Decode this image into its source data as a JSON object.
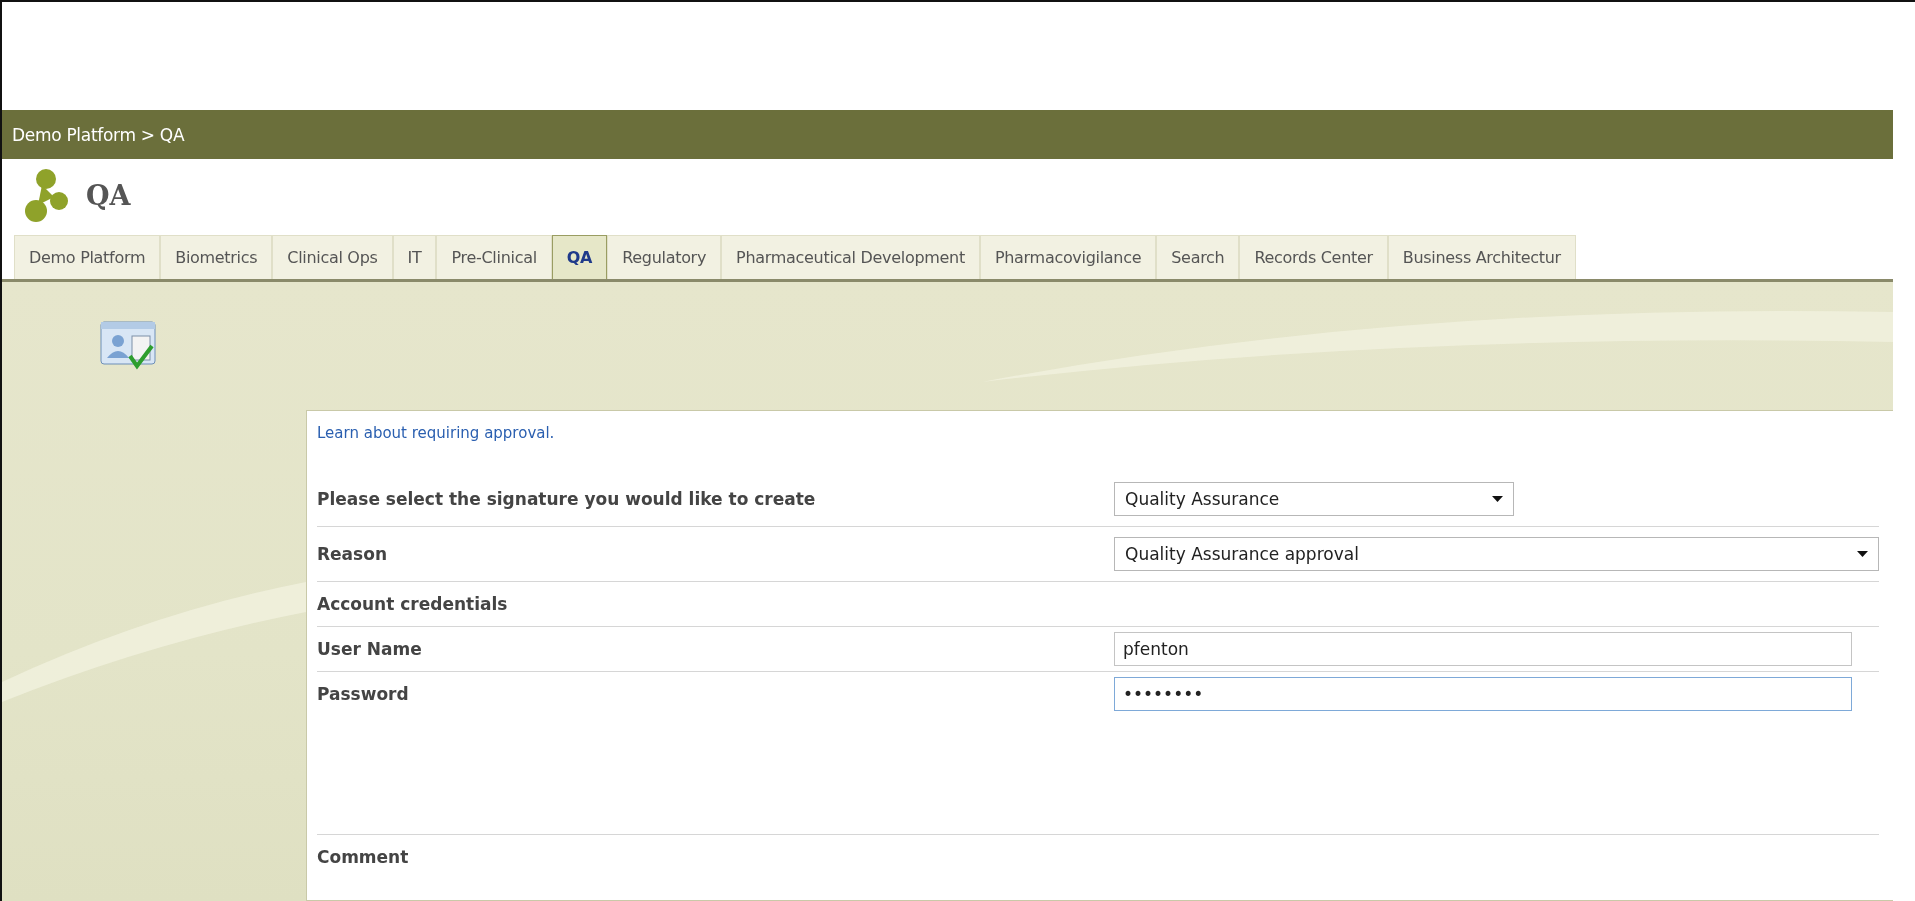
{
  "breadcrumb": "Demo Platform > QA",
  "site": {
    "title": "QA"
  },
  "tabs": [
    {
      "label": "Demo Platform",
      "selected": false
    },
    {
      "label": "Biometrics",
      "selected": false
    },
    {
      "label": "Clinical Ops",
      "selected": false
    },
    {
      "label": "IT",
      "selected": false
    },
    {
      "label": "Pre-Clinical",
      "selected": false
    },
    {
      "label": "QA",
      "selected": true
    },
    {
      "label": "Regulatory",
      "selected": false
    },
    {
      "label": "Pharmaceutical Development",
      "selected": false
    },
    {
      "label": "Pharmacovigilance",
      "selected": false
    },
    {
      "label": "Search",
      "selected": false
    },
    {
      "label": "Records Center",
      "selected": false
    },
    {
      "label": "Business Architectur",
      "selected": false
    }
  ],
  "form": {
    "link": "Learn about requiring approval.",
    "rows": [
      {
        "kind": "short-select",
        "label": "Please select the signature you would like to create",
        "value": "Quality Assurance"
      },
      {
        "kind": "select",
        "label": "Reason",
        "value": "Quality Assurance approval"
      },
      {
        "kind": "heading",
        "label": "Account credentials"
      },
      {
        "kind": "input",
        "label": "User Name",
        "value": "pfenton",
        "focused": false
      },
      {
        "kind": "input",
        "label": "Password",
        "value": "••••••••",
        "focused": true
      },
      {
        "kind": "comment",
        "label": "Comment"
      }
    ]
  }
}
